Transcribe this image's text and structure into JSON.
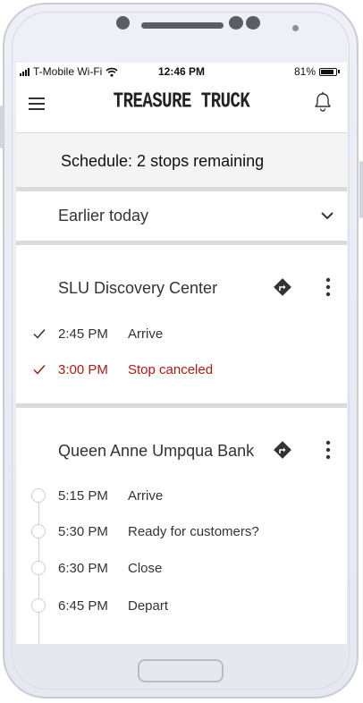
{
  "status_bar": {
    "carrier": "T-Mobile Wi-Fi",
    "time": "12:46 PM",
    "battery": "81%"
  },
  "header": {
    "logo": "TREASURE TRUCK",
    "menu_icon": "hamburger-menu-icon",
    "notifications_icon": "bell-icon"
  },
  "schedule": {
    "title": "Schedule: 2 stops remaining"
  },
  "earlier": {
    "label": "Earlier today",
    "icon": "chevron-down-icon"
  },
  "stops": [
    {
      "name": "SLU Discovery Center",
      "events": [
        {
          "time": "2:45 PM",
          "label": "Arrive",
          "state": "done"
        },
        {
          "time": "3:00 PM",
          "label": "Stop canceled",
          "state": "canceled"
        }
      ]
    },
    {
      "name": "Queen Anne Umpqua Bank",
      "events": [
        {
          "time": "5:15 PM",
          "label": "Arrive",
          "state": "pending"
        },
        {
          "time": "5:30 PM",
          "label": "Ready for customers?",
          "state": "pending"
        },
        {
          "time": "6:30 PM",
          "label": "Close",
          "state": "pending"
        },
        {
          "time": "6:45 PM",
          "label": "Depart",
          "state": "pending"
        }
      ]
    }
  ],
  "colors": {
    "canceled": "#b11a0e",
    "divider": "#dadcdc",
    "schedule_bg": "#f4f4f4"
  }
}
